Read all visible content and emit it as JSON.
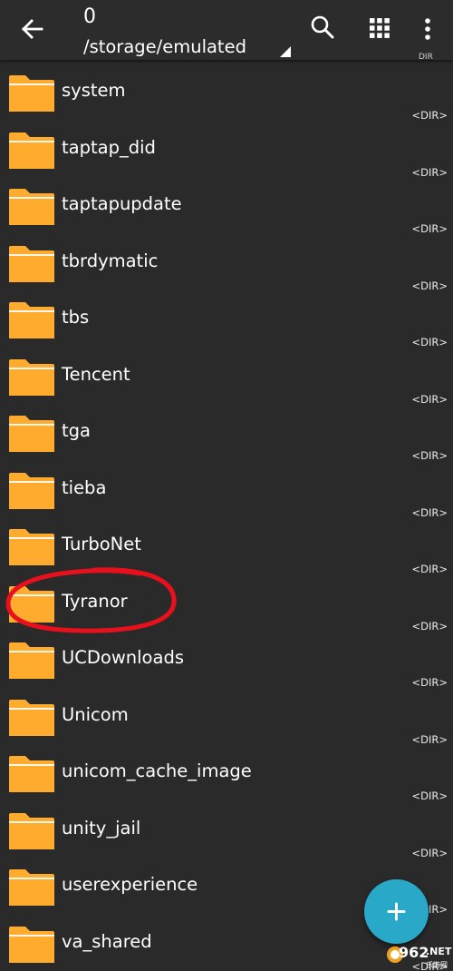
{
  "header": {
    "count": "0",
    "path": "/storage/emulated"
  },
  "scroll_hint": "DIR",
  "files": [
    {
      "name": "system",
      "type": "<DIR>"
    },
    {
      "name": "taptap_did",
      "type": "<DIR>"
    },
    {
      "name": "taptapupdate",
      "type": "<DIR>"
    },
    {
      "name": "tbrdymatic",
      "type": "<DIR>"
    },
    {
      "name": "tbs",
      "type": "<DIR>"
    },
    {
      "name": "Tencent",
      "type": "<DIR>"
    },
    {
      "name": "tga",
      "type": "<DIR>"
    },
    {
      "name": "tieba",
      "type": "<DIR>"
    },
    {
      "name": "TurboNet",
      "type": "<DIR>"
    },
    {
      "name": "Tyranor",
      "type": "<DIR>"
    },
    {
      "name": "UCDownloads",
      "type": "<DIR>"
    },
    {
      "name": "Unicom",
      "type": "<DIR>"
    },
    {
      "name": "unicom_cache_image",
      "type": "<DIR>"
    },
    {
      "name": "unity_jail",
      "type": "<DIR>"
    },
    {
      "name": "userexperience",
      "type": "<DIR>"
    },
    {
      "name": "va_shared",
      "type": "<DIR>"
    }
  ],
  "watermark": {
    "text": "962",
    "net": ".NET",
    "sub": "乐游网"
  },
  "colors": {
    "background": "#2a2a2a",
    "toolbar": "#2c2c2c",
    "folder": "#ffab2e",
    "fab": "#2aa8c8",
    "annotation": "#e8101c"
  },
  "icons": {
    "back": "arrow-back-icon",
    "search": "search-icon",
    "grid": "grid-view-icon",
    "more": "more-vert-icon",
    "folder": "folder-icon",
    "add": "plus-icon"
  }
}
